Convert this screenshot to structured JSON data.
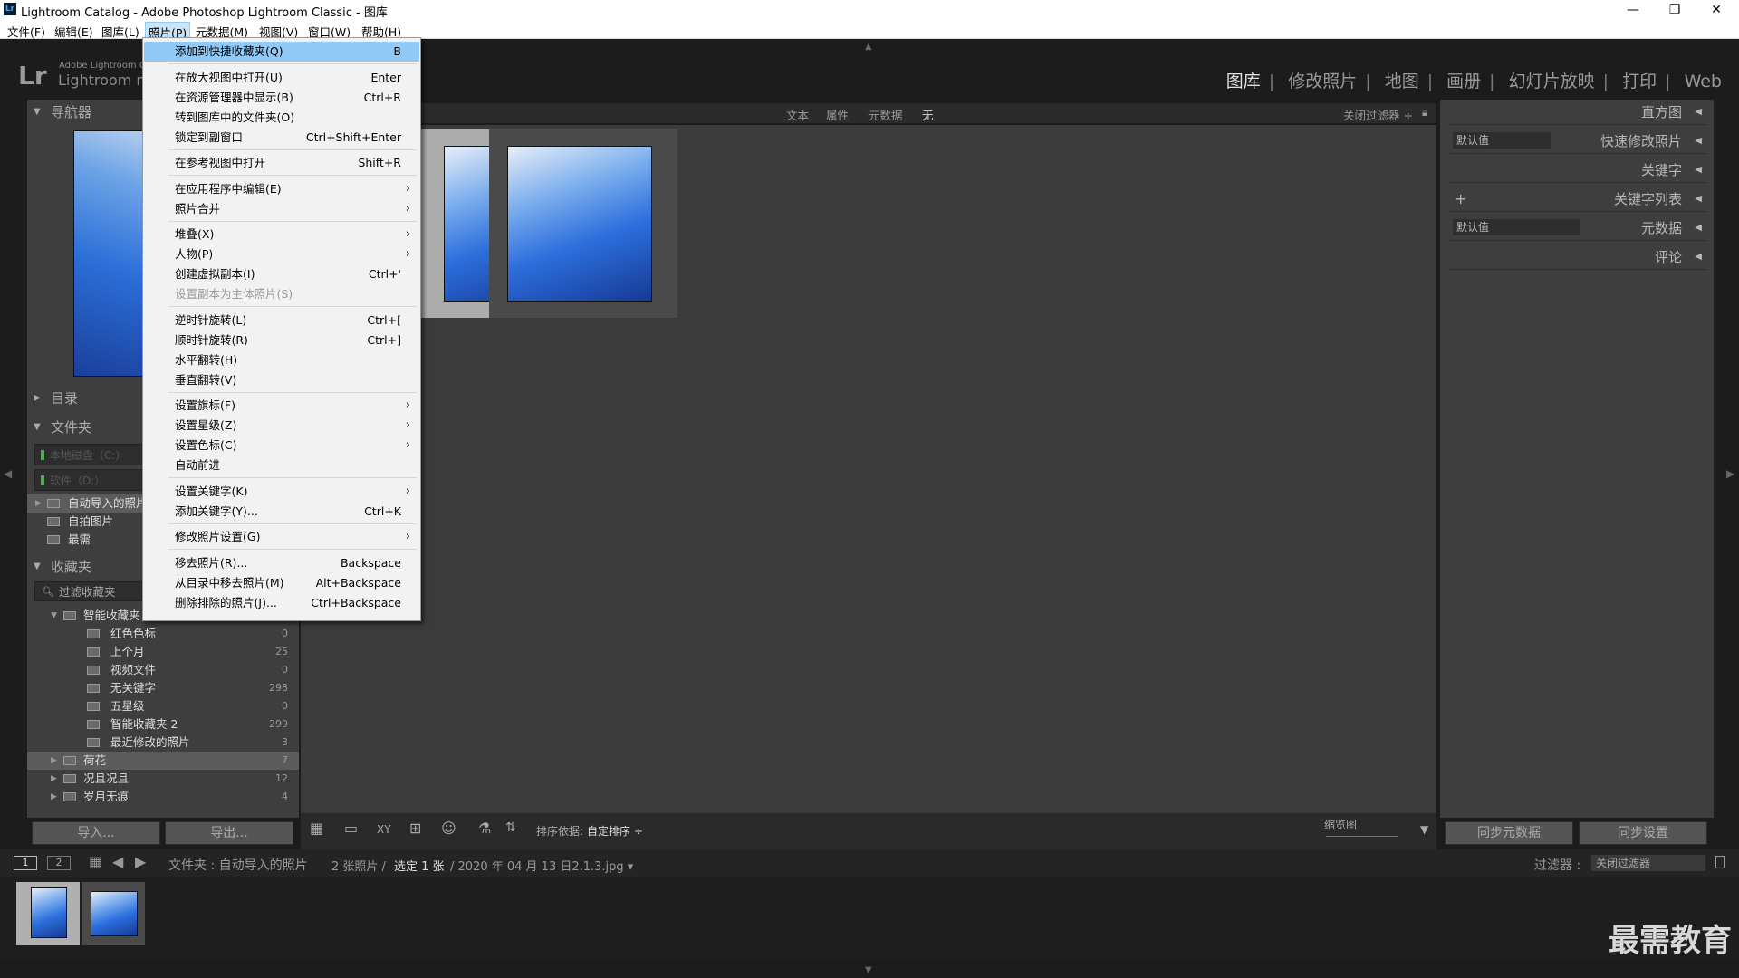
{
  "window": {
    "title": "Lightroom Catalog - Adobe Photoshop Lightroom Classic - 图库",
    "icon": "Lr",
    "min": "—",
    "max": "❐",
    "close": "✕"
  },
  "menubar": [
    "文件(F)",
    "编辑(E)",
    "图库(L)",
    "照片(P)",
    "元数据(M)",
    "视图(V)",
    "窗口(W)",
    "帮助(H)"
  ],
  "identity": {
    "logo": "Lr",
    "line1": "Adobe Lightroom C",
    "line2": "Lightroom m"
  },
  "modules": [
    "图库",
    "修改照片",
    "地图",
    "画册",
    "幻灯片放映",
    "打印",
    "Web"
  ],
  "left": {
    "navigator": "导航器",
    "catalog": "目录",
    "folders": "文件夹",
    "drive1": "本地磁盘（C:）",
    "drive2": "软件（D:）",
    "folder_items": [
      {
        "name": "自动导入的照片"
      },
      {
        "name": "自拍图片"
      },
      {
        "name": "最需"
      }
    ],
    "collections": "收藏夹",
    "filter": "过滤收藏夹",
    "smart": "智能收藏夹",
    "smart_items": [
      {
        "name": "红色色标",
        "count": "0"
      },
      {
        "name": "上个月",
        "count": "25"
      },
      {
        "name": "视频文件",
        "count": "0"
      },
      {
        "name": "无关键字",
        "count": "298"
      },
      {
        "name": "五星级",
        "count": "0"
      },
      {
        "name": "智能收藏夹 2",
        "count": "299"
      },
      {
        "name": "最近修改的照片",
        "count": "3"
      }
    ],
    "coll_items": [
      {
        "name": "荷花",
        "count": "7"
      },
      {
        "name": "况且况且",
        "count": "12"
      },
      {
        "name": "岁月无痕",
        "count": "4"
      }
    ],
    "import": "导入...",
    "export": "导出..."
  },
  "filterbar": {
    "text": "文本",
    "attr": "属性",
    "meta": "元数据",
    "none": "无",
    "off": "关闭过滤器 ÷"
  },
  "toolbar": {
    "sort_label": "排序依据:",
    "sort_value": "自定排序 ÷",
    "zoom": "缩览图"
  },
  "right": {
    "histogram": "直方图",
    "preset_default": "默认值",
    "quick_develop": "快速修改照片",
    "keywording": "关键字",
    "keyword_list": "关键字列表",
    "plus": "+",
    "metadata_default": "默认值",
    "metadata": "元数据",
    "comments": "评论",
    "sync_meta": "同步元数据",
    "sync_settings": "同步设置"
  },
  "filmbar": {
    "page1": "1",
    "page2": "2",
    "path": "文件夹 : 自动导入的照片",
    "count": "2 张照片 /",
    "selected": "选定 1 张",
    "file": "/ 2020 年 04 月 13 日2.1.3.jpg ▾",
    "filter_label": "过滤器 :",
    "filter_value": "关闭过滤器"
  },
  "photo_menu": {
    "items": [
      {
        "label": "添加到快捷收藏夹(Q)",
        "sc": "B",
        "hl": true
      },
      {
        "sep": true
      },
      {
        "label": "在放大视图中打开(U)",
        "sc": "Enter"
      },
      {
        "label": "在资源管理器中显示(B)",
        "sc": "Ctrl+R"
      },
      {
        "label": "转到图库中的文件夹(O)",
        "sc": ""
      },
      {
        "label": "锁定到副窗口",
        "sc": "Ctrl+Shift+Enter"
      },
      {
        "sep": true
      },
      {
        "label": "在参考视图中打开",
        "sc": "Shift+R"
      },
      {
        "sep": true
      },
      {
        "label": "在应用程序中编辑(E)",
        "sub": true
      },
      {
        "label": "照片合并",
        "sub": true
      },
      {
        "sep": true
      },
      {
        "label": "堆叠(X)",
        "sub": true
      },
      {
        "label": "人物(P)",
        "sub": true
      },
      {
        "label": "创建虚拟副本(I)",
        "sc": "Ctrl+'"
      },
      {
        "label": "设置副本为主体照片(S)",
        "dis": true
      },
      {
        "sep": true
      },
      {
        "label": "逆时针旋转(L)",
        "sc": "Ctrl+["
      },
      {
        "label": "顺时针旋转(R)",
        "sc": "Ctrl+]"
      },
      {
        "label": "水平翻转(H)"
      },
      {
        "label": "垂直翻转(V)"
      },
      {
        "sep": true
      },
      {
        "label": "设置旗标(F)",
        "sub": true
      },
      {
        "label": "设置星级(Z)",
        "sub": true
      },
      {
        "label": "设置色标(C)",
        "sub": true
      },
      {
        "label": "自动前进"
      },
      {
        "sep": true
      },
      {
        "label": "设置关键字(K)",
        "sub": true
      },
      {
        "label": "添加关键字(Y)...",
        "sc": "Ctrl+K"
      },
      {
        "sep": true
      },
      {
        "label": "修改照片设置(G)",
        "sub": true
      },
      {
        "sep": true
      },
      {
        "label": "移去照片(R)...",
        "sc": "Backspace"
      },
      {
        "label": "从目录中移去照片(M)",
        "sc": "Alt+Backspace"
      },
      {
        "label": "删除排除的照片(J)...",
        "sc": "Ctrl+Backspace"
      }
    ]
  },
  "watermark": "最需教育"
}
